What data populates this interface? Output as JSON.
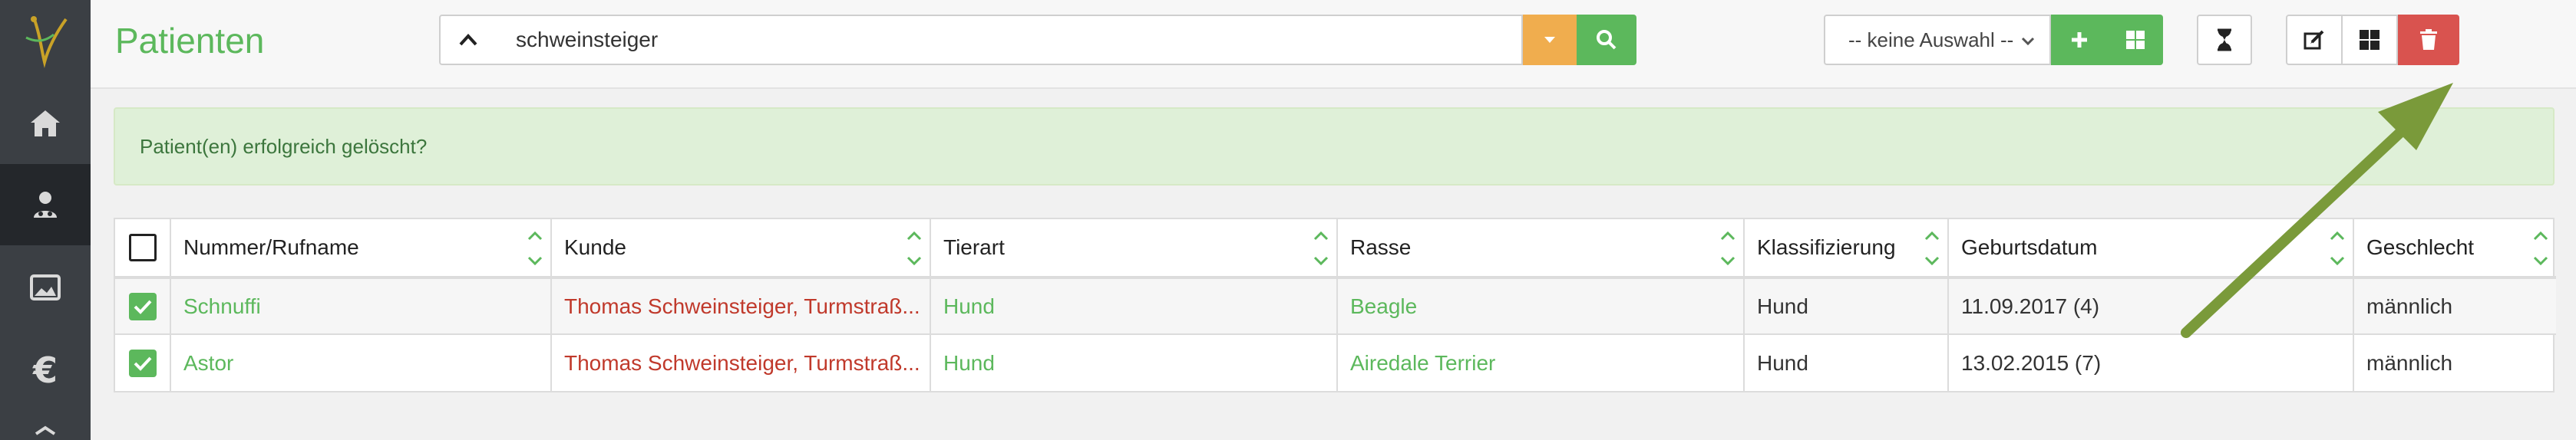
{
  "header": {
    "title": "Patienten",
    "search": {
      "value": "schweinsteiger"
    },
    "select": {
      "selected": "-- keine Auswahl --"
    }
  },
  "alert": {
    "message": "Patient(en) erfolgreich gelöscht?"
  },
  "table": {
    "columns": [
      "Nummer/Rufname",
      "Kunde",
      "Tierart",
      "Rasse",
      "Klassifizierung",
      "Geburtsdatum",
      "Geschlecht"
    ],
    "rows": [
      {
        "checked": true,
        "name": "Schnuffi",
        "customer": "Thomas Schweinsteiger, Turmstraß...",
        "species": "Hund",
        "breed": "Beagle",
        "classification": "Hund",
        "birthdate": "11.09.2017 (4)",
        "sex": "männlich"
      },
      {
        "checked": true,
        "name": "Astor",
        "customer": "Thomas Schweinsteiger, Turmstraß...",
        "species": "Hund",
        "breed": "Airedale Terrier",
        "classification": "Hund",
        "birthdate": "13.02.2015 (7)",
        "sex": "männlich"
      }
    ]
  },
  "colors": {
    "green": "#5cb85c",
    "orange": "#f0ad4e",
    "red": "#d9534f",
    "sidebar": "#3b3f44",
    "arrow": "#7a9a3a",
    "customer_text": "#c0392b"
  },
  "icons": [
    "logo-icon",
    "home-icon",
    "patients-icon",
    "image-icon",
    "euro-icon",
    "chevron-up-icon",
    "caret-down-icon",
    "search-icon",
    "plus-icon",
    "grid-icon",
    "hourglass-icon",
    "edit-icon",
    "trash-icon",
    "sort-icon",
    "arrow-annotation"
  ]
}
